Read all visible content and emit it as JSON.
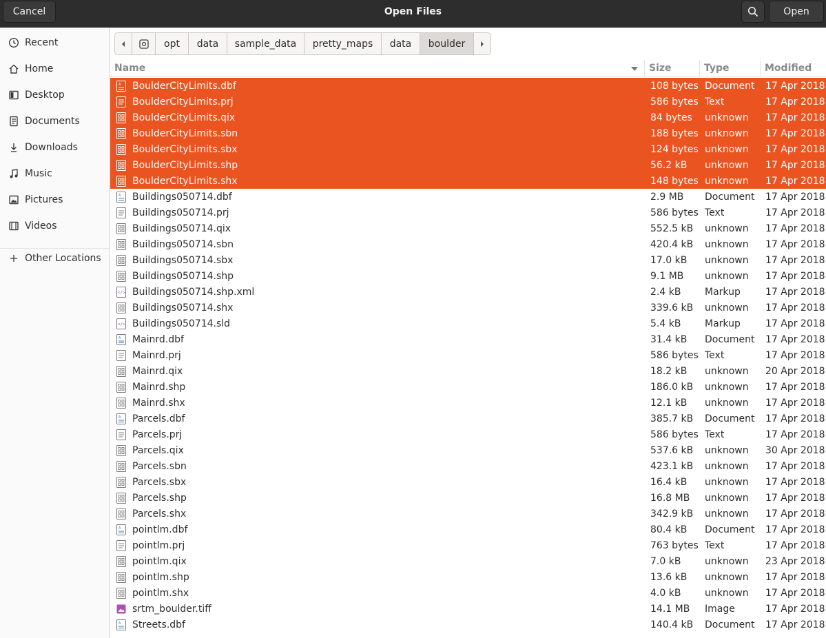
{
  "header": {
    "title": "Open Files",
    "cancel_label": "Cancel",
    "open_label": "Open",
    "search_icon": "search-icon"
  },
  "sidebar": {
    "items": [
      {
        "label": "Recent",
        "icon": "clock-icon"
      },
      {
        "label": "Home",
        "icon": "home-icon"
      },
      {
        "label": "Desktop",
        "icon": "desktop-icon"
      },
      {
        "label": "Documents",
        "icon": "document-icon"
      },
      {
        "label": "Downloads",
        "icon": "download-icon"
      },
      {
        "label": "Music",
        "icon": "music-icon"
      },
      {
        "label": "Pictures",
        "icon": "picture-icon"
      },
      {
        "label": "Videos",
        "icon": "video-icon"
      },
      {
        "label": "Other Locations",
        "icon": "plus-icon"
      }
    ]
  },
  "pathbar": {
    "segments": [
      "opt",
      "data",
      "sample_data",
      "pretty_maps",
      "data",
      "boulder"
    ],
    "active_index": 5
  },
  "columns": {
    "name": "Name",
    "size": "Size",
    "type": "Type",
    "modified": "Modified"
  },
  "colors": {
    "selection": "#e95420",
    "headerbar": "#2d2d2d"
  },
  "files": [
    {
      "name": "BoulderCityLimits.dbf",
      "size": "108 bytes",
      "type": "Document",
      "modified": "17 Apr 2018",
      "icon": "document-file-icon",
      "selected": true
    },
    {
      "name": "BoulderCityLimits.prj",
      "size": "586 bytes",
      "type": "Text",
      "modified": "17 Apr 2018",
      "icon": "text-file-icon",
      "selected": true
    },
    {
      "name": "BoulderCityLimits.qix",
      "size": "84 bytes",
      "type": "unknown",
      "modified": "17 Apr 2018",
      "icon": "binary-file-icon",
      "selected": true
    },
    {
      "name": "BoulderCityLimits.sbn",
      "size": "188 bytes",
      "type": "unknown",
      "modified": "17 Apr 2018",
      "icon": "binary-file-icon",
      "selected": true
    },
    {
      "name": "BoulderCityLimits.sbx",
      "size": "124 bytes",
      "type": "unknown",
      "modified": "17 Apr 2018",
      "icon": "binary-file-icon",
      "selected": true
    },
    {
      "name": "BoulderCityLimits.shp",
      "size": "56.2 kB",
      "type": "unknown",
      "modified": "17 Apr 2018",
      "icon": "binary-file-icon",
      "selected": true
    },
    {
      "name": "BoulderCityLimits.shx",
      "size": "148 bytes",
      "type": "unknown",
      "modified": "17 Apr 2018",
      "icon": "binary-file-icon",
      "selected": true
    },
    {
      "name": "Buildings050714.dbf",
      "size": "2.9 MB",
      "type": "Document",
      "modified": "17 Apr 2018",
      "icon": "document-file-icon",
      "selected": false
    },
    {
      "name": "Buildings050714.prj",
      "size": "586 bytes",
      "type": "Text",
      "modified": "17 Apr 2018",
      "icon": "text-file-icon",
      "selected": false
    },
    {
      "name": "Buildings050714.qix",
      "size": "552.5 kB",
      "type": "unknown",
      "modified": "17 Apr 2018",
      "icon": "binary-file-icon",
      "selected": false
    },
    {
      "name": "Buildings050714.sbn",
      "size": "420.4 kB",
      "type": "unknown",
      "modified": "17 Apr 2018",
      "icon": "binary-file-icon",
      "selected": false
    },
    {
      "name": "Buildings050714.sbx",
      "size": "17.0 kB",
      "type": "unknown",
      "modified": "17 Apr 2018",
      "icon": "binary-file-icon",
      "selected": false
    },
    {
      "name": "Buildings050714.shp",
      "size": "9.1 MB",
      "type": "unknown",
      "modified": "17 Apr 2018",
      "icon": "binary-file-icon",
      "selected": false
    },
    {
      "name": "Buildings050714.shp.xml",
      "size": "2.4 kB",
      "type": "Markup",
      "modified": "17 Apr 2018",
      "icon": "markup-file-icon",
      "selected": false
    },
    {
      "name": "Buildings050714.shx",
      "size": "339.6 kB",
      "type": "unknown",
      "modified": "17 Apr 2018",
      "icon": "binary-file-icon",
      "selected": false
    },
    {
      "name": "Buildings050714.sld",
      "size": "5.4 kB",
      "type": "Markup",
      "modified": "17 Apr 2018",
      "icon": "markup-file-icon",
      "selected": false
    },
    {
      "name": "Mainrd.dbf",
      "size": "31.4 kB",
      "type": "Document",
      "modified": "17 Apr 2018",
      "icon": "document-file-icon",
      "selected": false
    },
    {
      "name": "Mainrd.prj",
      "size": "586 bytes",
      "type": "Text",
      "modified": "17 Apr 2018",
      "icon": "text-file-icon",
      "selected": false
    },
    {
      "name": "Mainrd.qix",
      "size": "18.2 kB",
      "type": "unknown",
      "modified": "20 Apr 2018",
      "icon": "binary-file-icon",
      "selected": false
    },
    {
      "name": "Mainrd.shp",
      "size": "186.0 kB",
      "type": "unknown",
      "modified": "17 Apr 2018",
      "icon": "binary-file-icon",
      "selected": false
    },
    {
      "name": "Mainrd.shx",
      "size": "12.1 kB",
      "type": "unknown",
      "modified": "17 Apr 2018",
      "icon": "binary-file-icon",
      "selected": false
    },
    {
      "name": "Parcels.dbf",
      "size": "385.7 kB",
      "type": "Document",
      "modified": "17 Apr 2018",
      "icon": "document-file-icon",
      "selected": false
    },
    {
      "name": "Parcels.prj",
      "size": "586 bytes",
      "type": "Text",
      "modified": "17 Apr 2018",
      "icon": "text-file-icon",
      "selected": false
    },
    {
      "name": "Parcels.qix",
      "size": "537.6 kB",
      "type": "unknown",
      "modified": "30 Apr 2018",
      "icon": "binary-file-icon",
      "selected": false
    },
    {
      "name": "Parcels.sbn",
      "size": "423.1 kB",
      "type": "unknown",
      "modified": "17 Apr 2018",
      "icon": "binary-file-icon",
      "selected": false
    },
    {
      "name": "Parcels.sbx",
      "size": "16.4 kB",
      "type": "unknown",
      "modified": "17 Apr 2018",
      "icon": "binary-file-icon",
      "selected": false
    },
    {
      "name": "Parcels.shp",
      "size": "16.8 MB",
      "type": "unknown",
      "modified": "17 Apr 2018",
      "icon": "binary-file-icon",
      "selected": false
    },
    {
      "name": "Parcels.shx",
      "size": "342.9 kB",
      "type": "unknown",
      "modified": "17 Apr 2018",
      "icon": "binary-file-icon",
      "selected": false
    },
    {
      "name": "pointlm.dbf",
      "size": "80.4 kB",
      "type": "Document",
      "modified": "17 Apr 2018",
      "icon": "document-file-icon",
      "selected": false
    },
    {
      "name": "pointlm.prj",
      "size": "763 bytes",
      "type": "Text",
      "modified": "17 Apr 2018",
      "icon": "text-file-icon",
      "selected": false
    },
    {
      "name": "pointlm.qix",
      "size": "7.0 kB",
      "type": "unknown",
      "modified": "23 Apr 2018",
      "icon": "binary-file-icon",
      "selected": false
    },
    {
      "name": "pointlm.shp",
      "size": "13.6 kB",
      "type": "unknown",
      "modified": "17 Apr 2018",
      "icon": "binary-file-icon",
      "selected": false
    },
    {
      "name": "pointlm.shx",
      "size": "4.0 kB",
      "type": "unknown",
      "modified": "17 Apr 2018",
      "icon": "binary-file-icon",
      "selected": false
    },
    {
      "name": "srtm_boulder.tiff",
      "size": "14.1 MB",
      "type": "Image",
      "modified": "17 Apr 2018",
      "icon": "image-file-icon",
      "selected": false
    },
    {
      "name": "Streets.dbf",
      "size": "140.4 kB",
      "type": "Document",
      "modified": "17 Apr 2018",
      "icon": "document-file-icon",
      "selected": false
    }
  ]
}
